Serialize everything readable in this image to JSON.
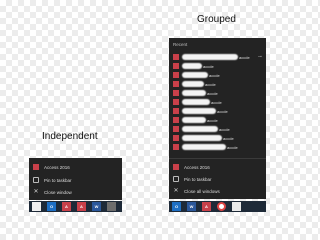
{
  "labels": {
    "grouped": "Grouped",
    "independent": "Independent"
  },
  "grouped_panel": {
    "section_header": "Recent",
    "recent_items": [
      {
        "suffix": "accde"
      },
      {
        "suffix": "accde"
      },
      {
        "suffix": "accde"
      },
      {
        "suffix": "accde"
      },
      {
        "suffix": "accde"
      },
      {
        "suffix": "accde"
      },
      {
        "suffix": "accde"
      },
      {
        "suffix": "accde"
      },
      {
        "suffix": "accde"
      },
      {
        "suffix": "accde"
      },
      {
        "suffix": "accde"
      }
    ],
    "menu": [
      {
        "label": "Access 2016",
        "icon": "access-icon"
      },
      {
        "label": "Pin to taskbar",
        "icon": "pin-icon"
      },
      {
        "label": "Close all windows",
        "icon": "close-icon"
      }
    ]
  },
  "independent_panel": {
    "menu": [
      {
        "label": "Access 2016",
        "icon": "access-icon"
      },
      {
        "label": "Pin to taskbar",
        "icon": "pin-icon"
      },
      {
        "label": "Close window",
        "icon": "close-icon"
      }
    ]
  },
  "colors": {
    "access_red": "#c9404a",
    "outlook_blue": "#1e6fc4",
    "panel_bg": "#232323",
    "taskbar_bg": "#1e2a38"
  }
}
